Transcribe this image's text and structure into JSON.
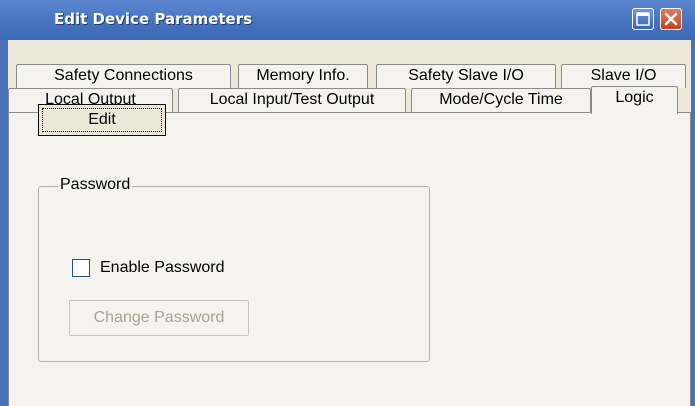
{
  "window": {
    "title": "Edit Device Parameters",
    "icons": {
      "maximize": "maximize-icon",
      "close": "close-icon"
    },
    "colors": {
      "titlebar": "#4672be",
      "close_button": "#c3411e",
      "dialog_bg": "#ece9d8"
    }
  },
  "tabs": {
    "row1": [
      "Safety Connections",
      "Memory Info.",
      "Safety Slave I/O",
      "Slave I/O"
    ],
    "row2": [
      "Local Output",
      "Local Input/Test Output",
      "Mode/Cycle Time",
      "Logic"
    ],
    "active": "Logic"
  },
  "logic": {
    "edit_button": "Edit",
    "password_group": {
      "legend": "Password",
      "enable_checkbox_label": "Enable Password",
      "enable_checked": false,
      "change_button": "Change Password",
      "change_enabled": false
    }
  }
}
